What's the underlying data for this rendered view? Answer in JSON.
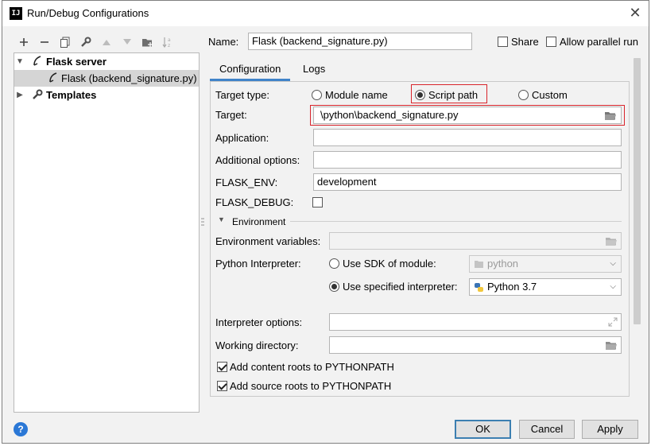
{
  "window": {
    "title": "Run/Debug Configurations",
    "app_icon_text": "IJ"
  },
  "toolbar": {
    "buttons": [
      "add-icon",
      "remove-icon",
      "copy-icon",
      "wrench-icon",
      "move-up-icon",
      "move-down-icon",
      "new-folder-icon",
      "sort-icon"
    ]
  },
  "tree": {
    "group_label": "Flask server",
    "config_label": "Flask (backend_signature.py)",
    "templates_label": "Templates"
  },
  "name_row": {
    "label": "Name:",
    "value": "Flask (backend_signature.py)",
    "share_label": "Share",
    "parallel_label": "Allow parallel run"
  },
  "tabs": [
    "Configuration",
    "Logs"
  ],
  "form": {
    "target_type_label": "Target type:",
    "target_type_options": [
      "Module name",
      "Script path",
      "Custom"
    ],
    "target_type_selected": "Script path",
    "target_label": "Target:",
    "target_value": "\\python\\backend_signature.py",
    "application_label": "Application:",
    "application_value": "",
    "additional_options_label": "Additional options:",
    "additional_options_value": "",
    "flask_env_label": "FLASK_ENV:",
    "flask_env_value": "development",
    "flask_debug_label": "FLASK_DEBUG:",
    "environment_section": "Environment",
    "env_vars_label": "Environment variables:",
    "env_vars_value": "",
    "python_interpreter_label": "Python Interpreter:",
    "use_sdk_label": "Use SDK of module:",
    "sdk_module_value": "python",
    "use_specified_label": "Use specified interpreter:",
    "interpreter_value": "Python 3.7",
    "interpreter_options_label": "Interpreter options:",
    "interpreter_options_value": "",
    "working_dir_label": "Working directory:",
    "working_dir_value": "",
    "add_content_roots_label": "Add content roots to PYTHONPATH",
    "add_source_roots_label": "Add source roots to PYTHONPATH"
  },
  "buttons": {
    "ok": "OK",
    "cancel": "Cancel",
    "apply": "Apply",
    "help": "?"
  },
  "colors": {
    "highlight": "#d9242b",
    "tab_accent": "#4083c9",
    "help": "#2b78d6"
  }
}
